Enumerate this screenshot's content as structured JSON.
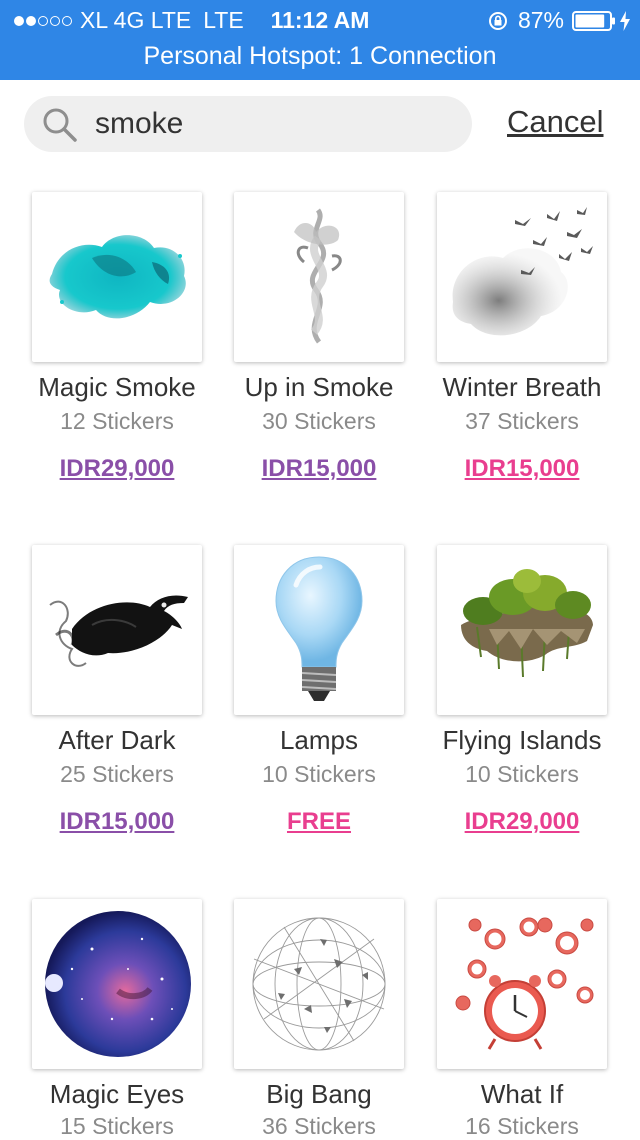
{
  "status_bar": {
    "carrier": "XL 4G LTE",
    "network": "LTE",
    "time": "11:12 AM",
    "battery": "87%",
    "battery_level": 0.87,
    "hotspot": "Personal Hotspot: 1 Connection"
  },
  "search": {
    "query": "smoke",
    "cancel_label": "Cancel"
  },
  "stickers": [
    {
      "title": "Magic Smoke",
      "count": "12 Stickers",
      "price": "IDR29,000",
      "price_color": "#8a4fa8"
    },
    {
      "title": "Up in Smoke",
      "count": "30 Stickers",
      "price": "IDR15,000",
      "price_color": "#8a4fa8"
    },
    {
      "title": "Winter Breath",
      "count": "37 Stickers",
      "price": "IDR15,000",
      "price_color": "#e93e8f"
    },
    {
      "title": "After Dark",
      "count": "25 Stickers",
      "price": "IDR15,000",
      "price_color": "#8a4fa8"
    },
    {
      "title": "Lamps",
      "count": "10 Stickers",
      "price": "FREE",
      "price_color": "#e93e8f"
    },
    {
      "title": "Flying Islands",
      "count": "10 Stickers",
      "price": "IDR29,000",
      "price_color": "#e93e8f"
    },
    {
      "title": "Magic Eyes",
      "count": "15 Stickers",
      "price": "",
      "price_color": "#8a4fa8"
    },
    {
      "title": "Big Bang",
      "count": "36 Stickers",
      "price": "",
      "price_color": "#8a4fa8"
    },
    {
      "title": "What If",
      "count": "16 Stickers",
      "price": "",
      "price_color": "#e93e8f"
    }
  ]
}
